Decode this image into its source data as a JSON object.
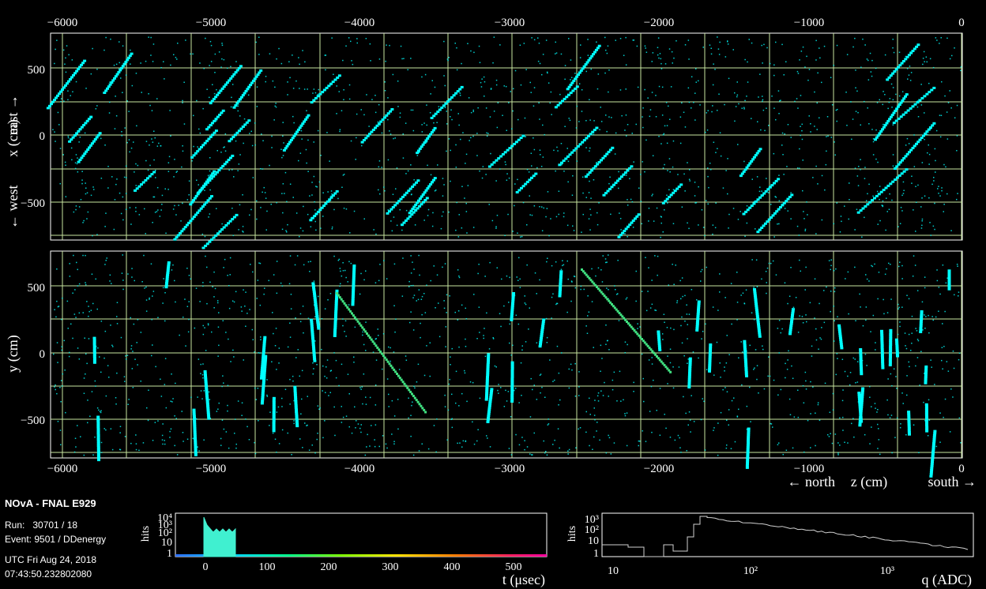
{
  "top_axis": {
    "ticks": [
      "−6000",
      "−5000",
      "−4000",
      "−3000",
      "−2000",
      "−1000",
      "0"
    ]
  },
  "xview": {
    "y_ticks": [
      "500",
      "0",
      "−500"
    ],
    "ylabel_left": "← west",
    "ylabel_mid": "x (cm)",
    "ylabel_right": "east →"
  },
  "yview": {
    "y_ticks": [
      "500",
      "0",
      "−500"
    ],
    "ylabel": "y (cm)"
  },
  "bottom_axis": {
    "ticks": [
      "−6000",
      "−5000",
      "−4000",
      "−3000",
      "−2000",
      "−1000",
      "0"
    ],
    "label_left": "← north",
    "label_mid": "z (cm)",
    "label_right": "south →"
  },
  "info": {
    "title": "NOvA - FNAL E929",
    "run": "Run:   30701 / 18",
    "event": "Event: 9501 / DDenergy",
    "utc": "UTC Fri Aug 24, 2018",
    "time": "07:43:50.232802080"
  },
  "time_hist": {
    "ylabel": "hits",
    "y_ticks": [
      "10⁴",
      "10³",
      "10²",
      "10",
      "1"
    ],
    "x_ticks": [
      "0",
      "100",
      "200",
      "300",
      "400",
      "500"
    ],
    "xlabel": "t (μsec)"
  },
  "charge_hist": {
    "ylabel": "hits",
    "y_ticks": [
      "10³",
      "10²",
      "10",
      "1"
    ],
    "x_ticks": [
      "10",
      "10²",
      "10³"
    ],
    "xlabel": "q (ADC)"
  },
  "colors": {
    "hit": "#00ffff",
    "grid": "#c8e6a0",
    "frame": "#ffffff",
    "track": "#40e080"
  }
}
